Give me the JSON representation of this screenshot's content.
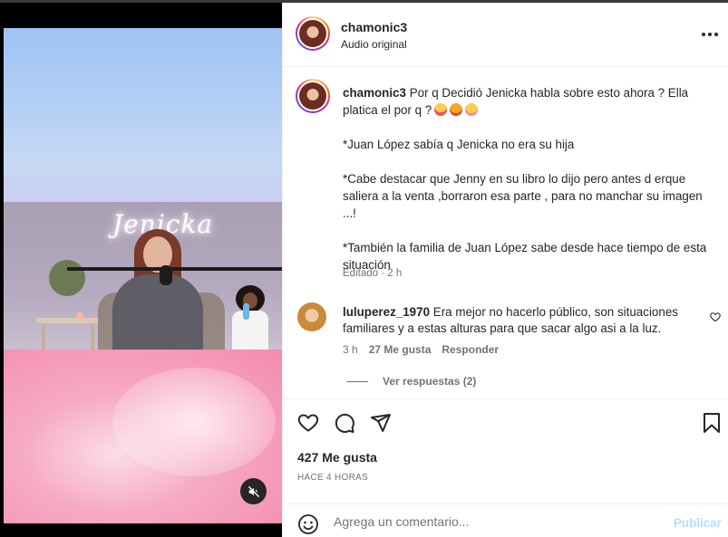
{
  "header": {
    "username": "chamonic3",
    "subtitle": "Audio original"
  },
  "caption": {
    "username": "chamonic3",
    "lines": [
      "Por q Decidió Jenicka habla sobre esto ahora ? Ella platica el por q ?",
      "*Juan López sabía q Jenicka no era su hija",
      "*Cabe destacar que Jenny en su libro lo dijo pero antes d erque saliera a la venta ,borraron esa parte , para no manchar su imagen ...!",
      "*También la familia de Juan López sabe desde hace tiempo de esta situación"
    ],
    "emojis": [
      "face-screaming",
      "face-angry",
      "face-woozy"
    ],
    "edited": "Editado · 2 h"
  },
  "comment": {
    "username": "luluperez_1970",
    "text": "Era mejor no hacerlo público, son situaciones familiares y a estas alturas para que sacar algo asi a la luz.",
    "time": "3 h",
    "likes": "27 Me gusta",
    "reply": "Responder",
    "view_replies": "Ver respuestas (2)"
  },
  "media": {
    "neon_text": "Jenicka",
    "muted": true
  },
  "stats": {
    "likes": "427 Me gusta",
    "time": "HACE 4 HORAS"
  },
  "composer": {
    "placeholder": "Agrega un comentario...",
    "post_label": "Publicar",
    "post_color": "#b2dffc"
  },
  "icons": [
    "heart-icon",
    "comment-icon",
    "share-icon",
    "bookmark-icon",
    "emoji-icon",
    "muted-speaker-icon",
    "more-icon"
  ]
}
